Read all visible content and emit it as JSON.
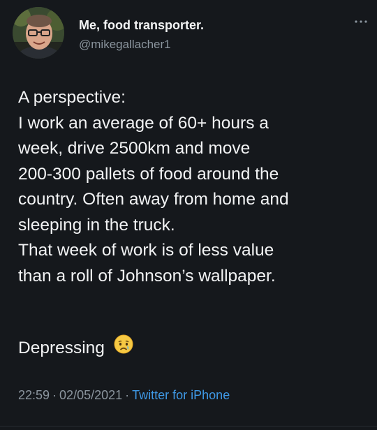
{
  "user": {
    "display_name": "Me, food transporter.",
    "handle": "@mikegallacher1"
  },
  "menu": {
    "icon": "more-dots-icon"
  },
  "tweet": {
    "lines": [
      "A perspective:",
      "I work an average of 60+ hours a",
      "week, drive 2500km and move",
      "200-300 pallets of food around the",
      "country. Often away from home and",
      "sleeping in the truck.",
      "That week of work is of less value",
      "than a roll of Johnson’s wallpaper."
    ],
    "closing": "Depressing",
    "closing_emoji": "crying-face-emoji"
  },
  "meta": {
    "time": "22:59",
    "date": "02/05/2021",
    "separator": "·",
    "source": "Twitter for iPhone"
  },
  "colors": {
    "background": "#15181c",
    "text": "#f2f3f4",
    "muted": "#8b959e",
    "link": "#3f99e6"
  }
}
